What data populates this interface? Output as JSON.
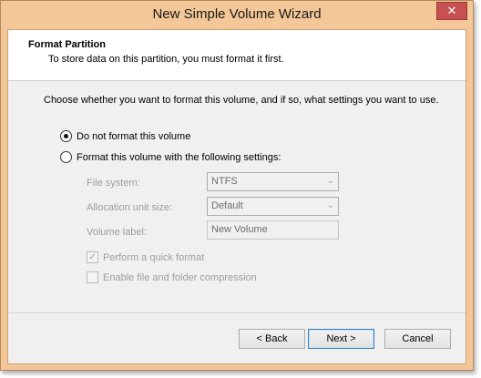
{
  "window": {
    "title": "New Simple Volume Wizard",
    "close_glyph": "✕"
  },
  "header": {
    "title": "Format Partition",
    "subtitle": "To store data on this partition, you must format it first."
  },
  "body": {
    "intro": "Choose whether you want to format this volume, and if so, what settings you want to use.",
    "options": [
      {
        "label": "Do not format this volume",
        "selected": true
      },
      {
        "label": "Format this volume with the following settings:",
        "selected": false
      }
    ],
    "settings": {
      "file_system_label": "File system:",
      "file_system_value": "NTFS",
      "allocation_label": "Allocation unit size:",
      "allocation_value": "Default",
      "volume_label_label": "Volume label:",
      "volume_label_value": "New Volume",
      "quick_format_label": "Perform a quick format",
      "quick_format_checked": true,
      "compression_label": "Enable file and folder compression",
      "compression_checked": false
    }
  },
  "buttons": {
    "back": "< Back",
    "next": "Next >",
    "cancel": "Cancel"
  },
  "colors": {
    "titlebar": "#f3c797",
    "close_button": "#c75050",
    "disabled_text": "#9d9d9d"
  }
}
